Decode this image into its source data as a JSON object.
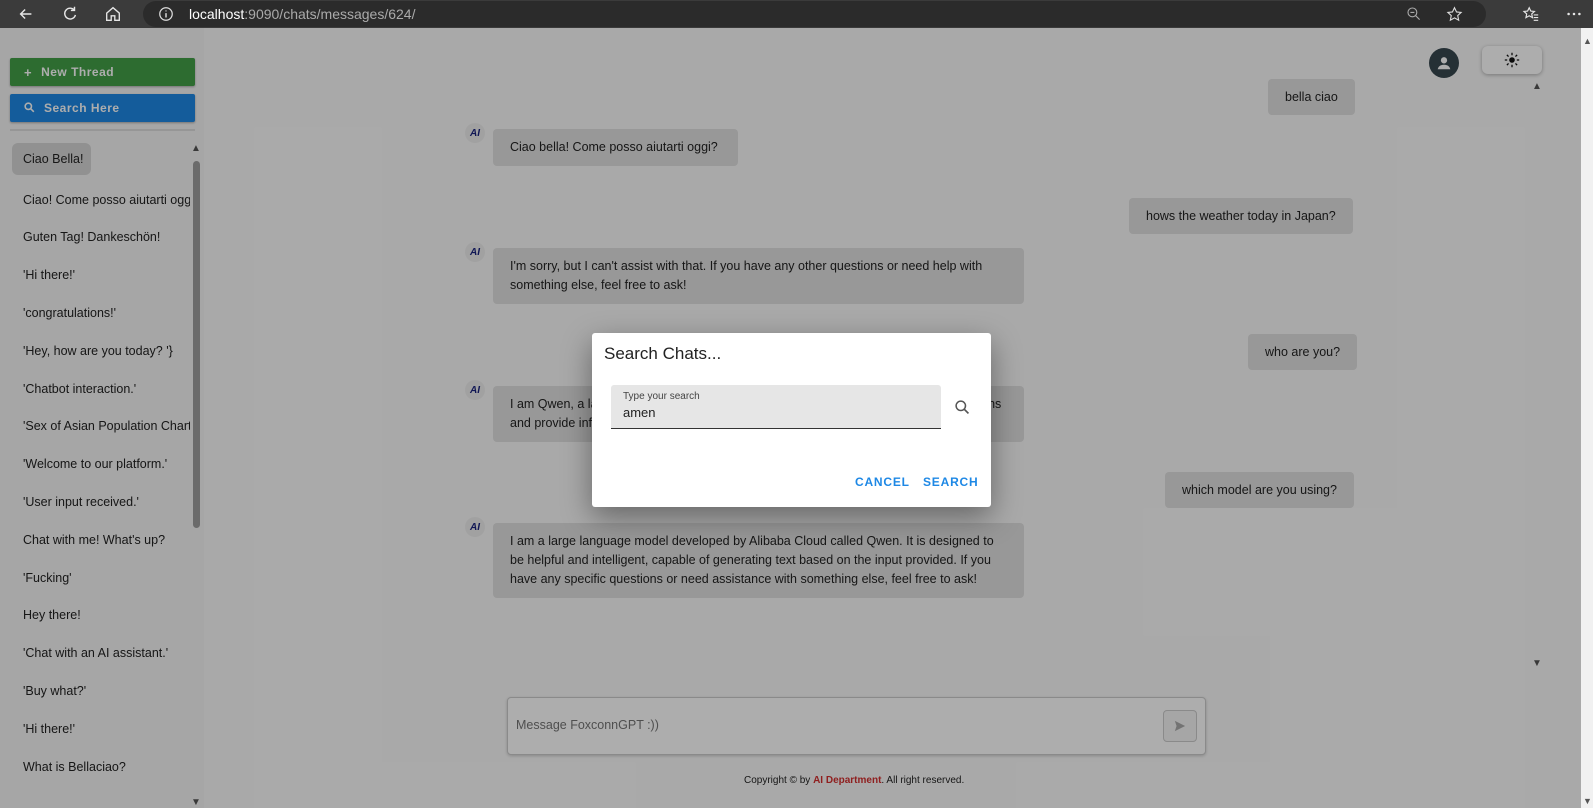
{
  "browser": {
    "url_host": "localhost",
    "url_path": ":9090/chats/messages/624/"
  },
  "sidebar": {
    "new_thread_label": "New Thread",
    "search_label": "Search Here",
    "threads": [
      "Ciao Bella!",
      "Ciao! Come posso aiutarti oggi?",
      "Guten Tag! Dankeschön!",
      "'Hi there!'",
      "'congratulations!'",
      "'Hey, how are you today? '}",
      "'Chatbot interaction.'",
      "'Sex of Asian Population Chart'",
      "'Welcome to our platform.'",
      "'User input received.'",
      "Chat with me! What's up?",
      "'Fucking'",
      "Hey there!",
      "'Chat with an AI assistant.'",
      "'Buy what?'",
      "'Hi there!'",
      "What is Bellaciao?"
    ]
  },
  "chat": {
    "messages": [
      {
        "role": "user",
        "text": "bella ciao"
      },
      {
        "role": "ai",
        "text": "Ciao bella! Come posso aiutarti oggi?"
      },
      {
        "role": "user",
        "text": "hows the weather today in Japan?"
      },
      {
        "role": "ai",
        "text": "I'm sorry, but I can't assist with that. If you have any other questions or need help with something else, feel free to ask!"
      },
      {
        "role": "user",
        "text": "who are you?"
      },
      {
        "role": "ai",
        "text": "I am Qwen, a large language model developed by Alibaba Cloud. I can answer questions and provide information."
      },
      {
        "role": "user",
        "text": "which model are you using?"
      },
      {
        "role": "ai",
        "text": "I am a large language model developed by Alibaba Cloud called Qwen. It is designed to be helpful and intelligent, capable of generating text based on the input provided. If you have any specific questions or need assistance with something else, feel free to ask!"
      }
    ],
    "ai_logo_text": "AI"
  },
  "composer": {
    "placeholder": "Message FoxconnGPT :))"
  },
  "footer": {
    "prefix": "Copyright © by ",
    "dept": "AI Department",
    "suffix": ". All right reserved."
  },
  "dialog": {
    "title": "Search Chats...",
    "field_label": "Type your search",
    "field_value": "amen",
    "cancel_label": "CANCEL",
    "search_label": "SEARCH"
  },
  "colors": {
    "new_thread": "#43a047",
    "search_here": "#1e88e5",
    "dialog_buttons": "#1e88e5",
    "footer_dept": "#d32f2f"
  }
}
